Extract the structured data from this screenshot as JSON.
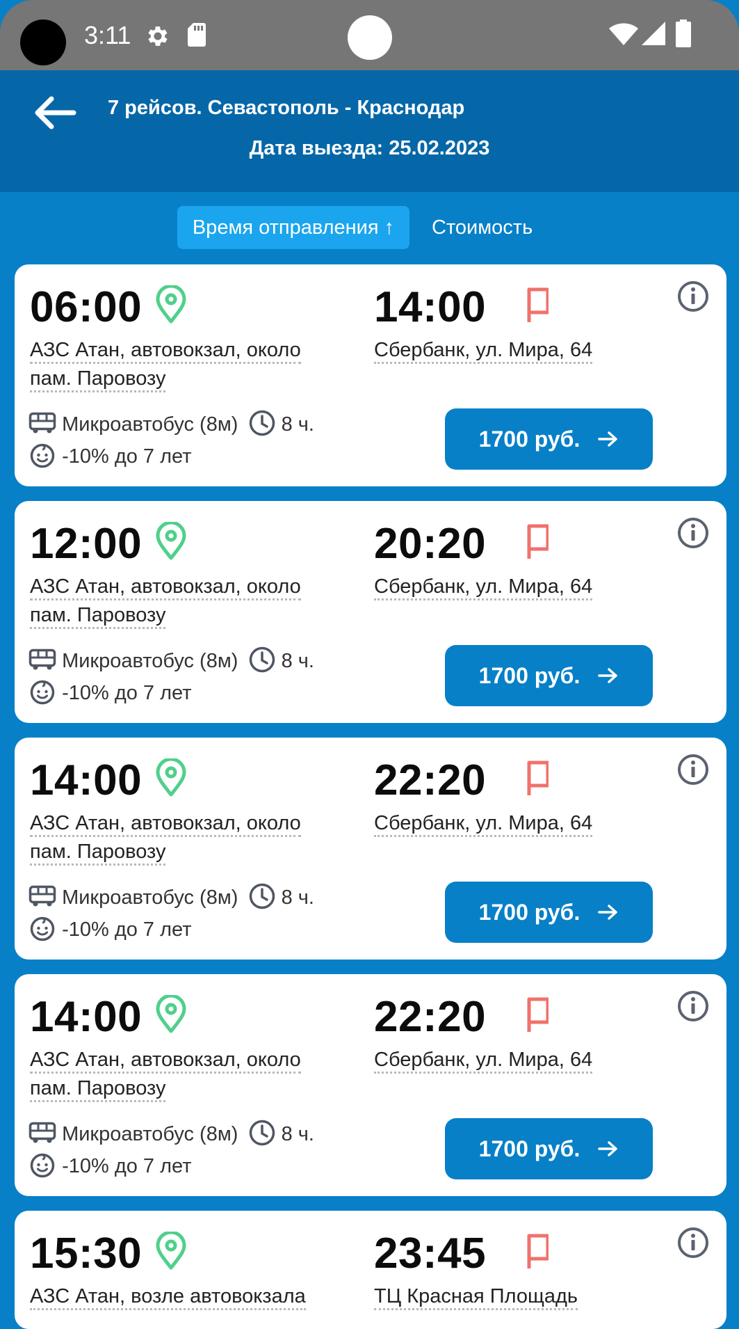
{
  "status_bar": {
    "time": "3:11"
  },
  "header": {
    "title": "7 рейсов. Севастополь - Краснодар",
    "date_line": "Дата выезда: 25.02.2023"
  },
  "sort_tabs": {
    "departure_time": "Время отправления ↑",
    "price": "Стоимость"
  },
  "trips": [
    {
      "departure_time": "06:00",
      "arrival_time": "14:00",
      "departure_place_line1": "АЗС Атан, автовокзал, около",
      "departure_place_line2": "пам. Паровозу",
      "arrival_place": "Сбербанк, ул. Мира, 64",
      "vehicle": "Микроавтобус (8м)",
      "duration": "8 ч.",
      "discount": "-10% до 7 лет",
      "price": "1700 руб."
    },
    {
      "departure_time": "12:00",
      "arrival_time": "20:20",
      "departure_place_line1": "АЗС Атан, автовокзал, около",
      "departure_place_line2": "пам. Паровозу",
      "arrival_place": "Сбербанк, ул. Мира, 64",
      "vehicle": "Микроавтобус (8м)",
      "duration": "8 ч.",
      "discount": "-10% до 7 лет",
      "price": "1700 руб."
    },
    {
      "departure_time": "14:00",
      "arrival_time": "22:20",
      "departure_place_line1": "АЗС Атан, автовокзал, около",
      "departure_place_line2": "пам. Паровозу",
      "arrival_place": "Сбербанк, ул. Мира, 64",
      "vehicle": "Микроавтобус (8м)",
      "duration": "8 ч.",
      "discount": "-10% до 7 лет",
      "price": "1700 руб."
    },
    {
      "departure_time": "14:00",
      "arrival_time": "22:20",
      "departure_place_line1": "АЗС Атан, автовокзал, около",
      "departure_place_line2": "пам. Паровозу",
      "arrival_place": "Сбербанк, ул. Мира, 64",
      "vehicle": "Микроавтобус (8м)",
      "duration": "8 ч.",
      "discount": "-10% до 7 лет",
      "price": "1700 руб."
    },
    {
      "departure_time": "15:30",
      "arrival_time": "23:45",
      "departure_place_line1": "АЗС Атан, возле автовокзала",
      "arrival_place": "ТЦ Красная Площадь"
    }
  ],
  "icons": {
    "status_settings": "gear-icon",
    "status_sd": "sd-card-icon",
    "status_wifi": "wifi-icon",
    "status_signal": "signal-icon",
    "status_battery": "battery-icon",
    "back": "arrow-left-icon",
    "departure": "map-pin-icon",
    "arrival": "flag-icon",
    "info": "info-icon",
    "vehicle": "bus-icon",
    "duration": "clock-icon",
    "discount": "child-face-icon",
    "price_arrow": "arrow-right-icon"
  },
  "colors": {
    "status_bar": "#767676",
    "header": "#0667a8",
    "background": "#0780c8",
    "active_tab": "#1ba5ee",
    "price_button": "#0780c8",
    "pin": "#4fd08a",
    "flag": "#f0726b",
    "card": "#ffffff"
  }
}
